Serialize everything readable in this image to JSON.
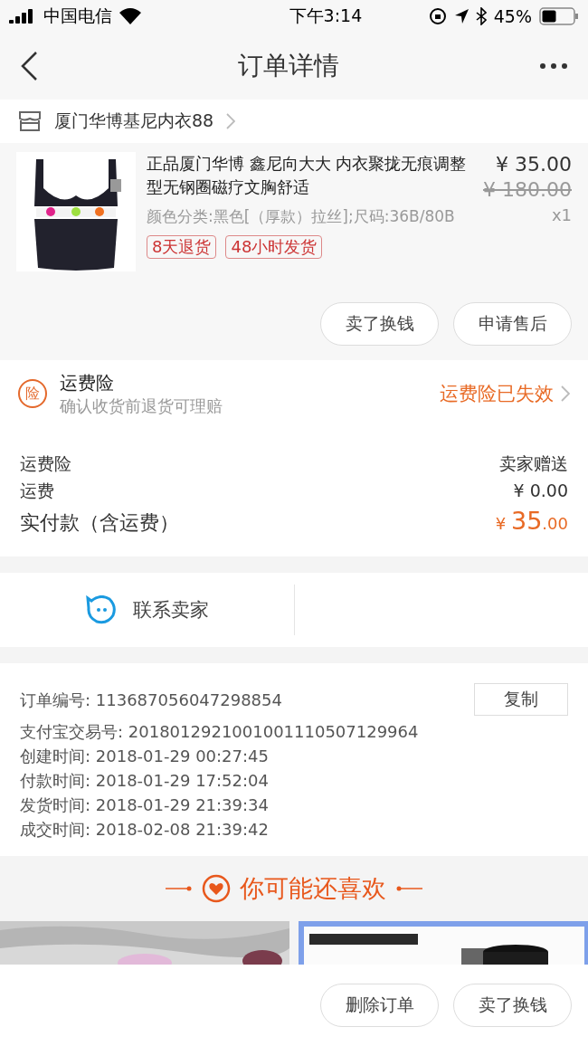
{
  "status_bar": {
    "carrier": "中国电信",
    "time": "下午3:14",
    "battery": "45%"
  },
  "nav": {
    "title": "订单详情"
  },
  "shop": {
    "name": "厦门华博基尼内衣88"
  },
  "product": {
    "kind": "picture",
    "title": "正品厦门华博 鑫尼向大大 内衣聚拢无痕调整型无钢圈磁疗文胸舒适",
    "sku": "颜色分类:黑色[（厚款）拉丝];尺码:36B/80B",
    "price": "¥ 35.00",
    "original_price": "¥ 180.00",
    "quantity": "x1",
    "tags": [
      "8天退货",
      "48小时发货"
    ],
    "actions": [
      "卖了换钱",
      "申请售后"
    ]
  },
  "insurance": {
    "badge": "险",
    "title": "运费险",
    "subtitle": "确认收货前退货可理赔",
    "status": "运费险已失效"
  },
  "fees": [
    {
      "label": "运费险",
      "value": "卖家赠送",
      "kind": "plain"
    },
    {
      "label": "运费",
      "value": "¥ 0.00",
      "kind": "plain"
    },
    {
      "label": "实付款（含运费）",
      "currency": "¥",
      "value": "35",
      "decimals": ".00",
      "kind": "total"
    }
  ],
  "contact": {
    "label": "联系卖家"
  },
  "order_info": {
    "copy_button": "复制",
    "rows": [
      {
        "label": "订单编号:",
        "value": "113687056047298854"
      },
      {
        "label": "支付宝交易号:",
        "value": "2018012921001001110507129964"
      },
      {
        "label": "创建时间:",
        "value": "2018-01-29 00:27:45"
      },
      {
        "label": "付款时间:",
        "value": "2018-01-29 17:52:04"
      },
      {
        "label": "发货时间:",
        "value": "2018-01-29 21:39:34"
      },
      {
        "label": "成交时间:",
        "value": "2018-02-08 21:39:42"
      }
    ]
  },
  "recommend": {
    "title": "你可能还喜欢"
  },
  "bottom_actions": [
    "删除订单",
    "卖了换钱"
  ]
}
